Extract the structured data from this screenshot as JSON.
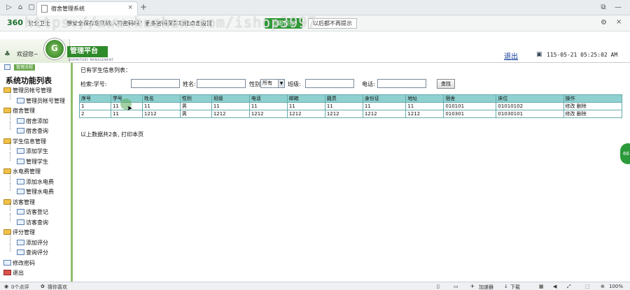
{
  "browser": {
    "tab_title": "宿舍管理系统",
    "tab_close": "×",
    "new_tab": "+",
    "nav_back": "▷",
    "nav_home": "⌂",
    "nav_icon3": "▢",
    "window_btn1": "⧉",
    "window_btn2": "—"
  },
  "notice": {
    "brand": "360",
    "brand_sub": "安全卫士",
    "message": "想安全保存您刚输入的密码吗？更多密码保存功能点击设置",
    "button_label": "立即保存",
    "dismiss_label": "以后都不再提示"
  },
  "watermark": "https://www.huzhan.com/ishop3997",
  "header": {
    "welcome": "欢迎您~",
    "platform": "管理平台",
    "platform_sub": "DORMITORY MANAGEMENT",
    "logout": "退出",
    "datetime": "115-05-21 05:25:02 AM"
  },
  "sidebar": {
    "tab": "管理流程",
    "title": "系统功能列表",
    "items": [
      {
        "label": "管理员帐号管理",
        "level": 0
      },
      {
        "label": "管理员帐号管理",
        "level": 1
      },
      {
        "label": "宿舍管理",
        "level": 0
      },
      {
        "label": "宿舍添加",
        "level": 1
      },
      {
        "label": "宿舍查询",
        "level": 1
      },
      {
        "label": "学生信息管理",
        "level": 0
      },
      {
        "label": "添加学生",
        "level": 1
      },
      {
        "label": "管理学生",
        "level": 1
      },
      {
        "label": "水电费管理",
        "level": 0
      },
      {
        "label": "添加水电费",
        "level": 1
      },
      {
        "label": "管理水电费",
        "level": 1
      },
      {
        "label": "访客管理",
        "level": 0
      },
      {
        "label": "访客登记",
        "level": 1
      },
      {
        "label": "访客查询",
        "level": 1
      },
      {
        "label": "评分管理",
        "level": 0
      },
      {
        "label": "添加评分",
        "level": 1
      },
      {
        "label": "查询评分",
        "level": 1
      },
      {
        "label": "修改密码",
        "level": 0
      },
      {
        "label": "退出",
        "level": 0
      }
    ]
  },
  "main": {
    "all_label": "已有学生信息列表：",
    "search": {
      "label_search_id": "检索:学号:",
      "label_name": "姓名:",
      "label_gender": "性别:",
      "gender_value": "所有",
      "label_class": "班级:",
      "label_phone": "电话:",
      "button": "查找"
    },
    "columns": [
      "序号",
      "学号",
      "姓名",
      "性别",
      "班级",
      "电话",
      "邮箱",
      "籍贯",
      "身份证",
      "地址",
      "宿舍",
      "床位",
      "操作"
    ],
    "rows": [
      [
        "1",
        "11",
        "11",
        "男",
        "11",
        "11",
        "11",
        "11",
        "11",
        "11",
        "010101",
        "01010102",
        "修改  删除"
      ],
      [
        "2",
        "11",
        "1212",
        "男",
        "1212",
        "1212",
        "1212",
        "1212",
        "1212",
        "1212",
        "010301",
        "01030101",
        "修改  删除"
      ]
    ],
    "summary": "以上数据共2条, 打印本页"
  },
  "float_badge": "66",
  "statusbar": {
    "left1": "0个点评",
    "left2": "猜你喜欢",
    "accelerator": "加速器",
    "download": "下载",
    "zoom": "100%"
  }
}
